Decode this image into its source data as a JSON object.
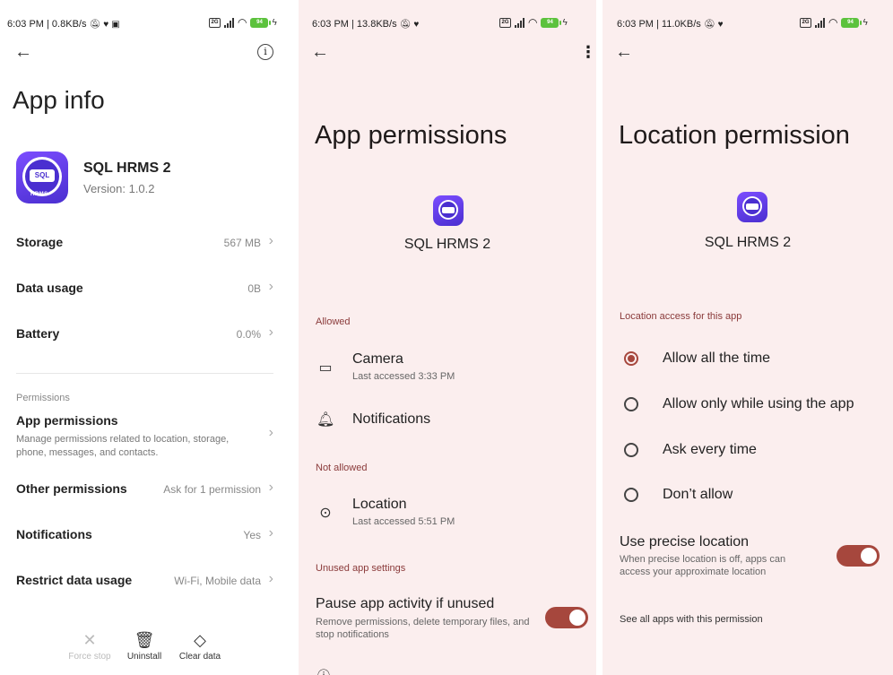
{
  "app_info": {
    "status_bar": {
      "text": "6:03 PM | 0.8KB/s",
      "battery": "94"
    },
    "title": "App info",
    "app_name": "SQL HRMS 2",
    "version": "Version: 1.0.2",
    "icon": {
      "name": "sql-hrms-app-icon",
      "label": "HRMS"
    },
    "rows": {
      "storage": {
        "label": "Storage",
        "value": "567 MB"
      },
      "data_usage": {
        "label": "Data usage",
        "value": "0B"
      },
      "battery": {
        "label": "Battery",
        "value": "0.0%"
      }
    },
    "permissions_section": "Permissions",
    "app_permissions": {
      "label": "App permissions",
      "description": "Manage permissions related to location, storage, phone, messages, and contacts."
    },
    "other_permissions": {
      "label": "Other permissions",
      "value": "Ask for 1 permission"
    },
    "notifications": {
      "label": "Notifications",
      "value": "Yes"
    },
    "restrict_data": {
      "label": "Restrict data usage",
      "value": "Wi-Fi, Mobile data"
    },
    "bottom_actions": {
      "force_stop": "Force stop",
      "uninstall": "Uninstall",
      "clear_data": "Clear data"
    }
  },
  "app_permissions": {
    "status_bar": {
      "text": "6:03 PM | 13.8KB/s",
      "battery": "94"
    },
    "title": "App permissions",
    "app_name": "SQL HRMS 2",
    "allowed_header": "Allowed",
    "camera": {
      "title": "Camera",
      "sub": "Last accessed 3:33 PM"
    },
    "notifications": {
      "title": "Notifications"
    },
    "not_allowed_header": "Not allowed",
    "location": {
      "title": "Location",
      "sub": "Last accessed 5:51 PM"
    },
    "unused_header": "Unused app settings",
    "pause": {
      "title": "Pause app activity if unused",
      "sub": "Remove permissions, delete temporary files, and stop notifications",
      "enabled": true
    }
  },
  "location_permission": {
    "status_bar": {
      "text": "6:03 PM | 11.0KB/s",
      "battery": "94"
    },
    "title": "Location permission",
    "app_name": "SQL HRMS 2",
    "section": "Location access for this app",
    "options": [
      {
        "label": "Allow all the time",
        "selected": true
      },
      {
        "label": "Allow only while using the app",
        "selected": false
      },
      {
        "label": "Ask every time",
        "selected": false
      },
      {
        "label": "Don’t allow",
        "selected": false
      }
    ],
    "precise": {
      "title": "Use precise location",
      "sub": "When precise location is off, apps can access your approximate location",
      "enabled": true
    },
    "see_all": "See all apps with this permission"
  },
  "colors": {
    "accent": "#a6473d",
    "panel_bg": "#fbeeee",
    "app_icon": "#5a36e0",
    "battery": "#5cc23d"
  }
}
